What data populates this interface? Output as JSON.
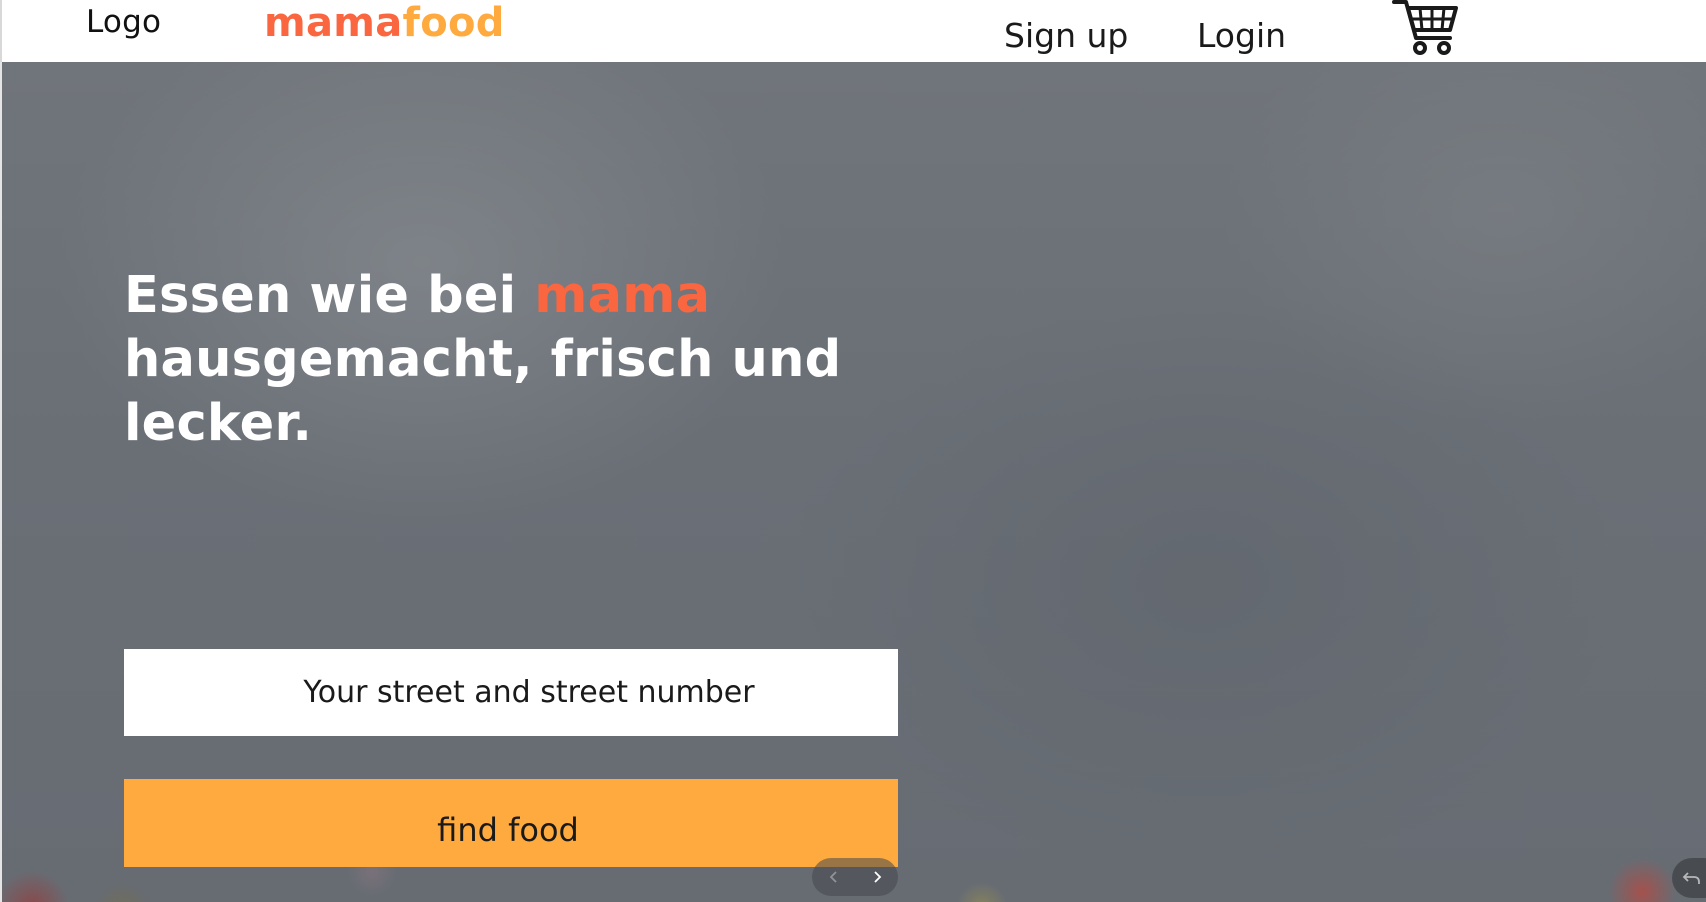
{
  "header": {
    "logo_text": "Logo",
    "brand_part1": "mama",
    "brand_part2": "food",
    "signup_label": "Sign up",
    "login_label": "Login",
    "cart_icon": "shopping-cart-icon"
  },
  "hero": {
    "headline_part1": "Essen wie bei ",
    "headline_accent": "mama",
    "headline_part2": "hausgemacht, frisch und lecker.",
    "address_placeholder": "Your street and street number",
    "find_button_label": "find food"
  },
  "carousel": {
    "prev_icon": "chevron-left-icon",
    "next_icon": "chevron-right-icon"
  },
  "colors": {
    "accent": "#fa6640",
    "accent2": "#ffaa3e"
  }
}
